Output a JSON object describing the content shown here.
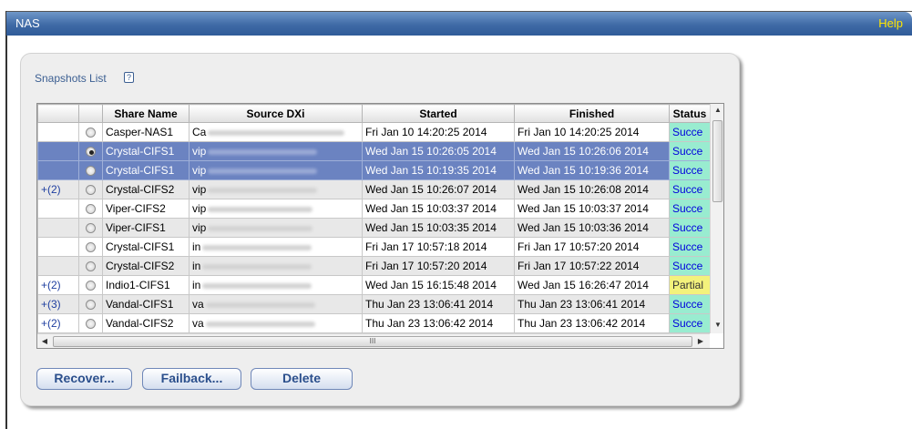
{
  "window": {
    "title": "NAS",
    "help_label": "Help"
  },
  "section": {
    "title": "Snapshots List",
    "help_icon": "?"
  },
  "table": {
    "columns": [
      "",
      "",
      "Share Name",
      "Source DXi",
      "Started",
      "Finished",
      "Status"
    ],
    "rows": [
      {
        "expand": "",
        "selected": false,
        "share": "Casper-NAS1",
        "source": "Ca",
        "started": "Fri Jan 10 14:20:25 2014",
        "finished": "Fri Jan 10 14:20:25 2014",
        "status": "Succe"
      },
      {
        "expand": "",
        "selected": true,
        "share": "Crystal-CIFS1",
        "source": "vip",
        "started": "Wed Jan 15 10:26:05 2014",
        "finished": "Wed Jan 15 10:26:06 2014",
        "status": "Succe"
      },
      {
        "expand": "",
        "selected": false,
        "share": "Crystal-CIFS1",
        "source": "vip",
        "started": "Wed Jan 15 10:19:35 2014",
        "finished": "Wed Jan 15 10:19:36 2014",
        "status": "Succe"
      },
      {
        "expand": "+(2)",
        "selected": false,
        "share": "Crystal-CIFS2",
        "source": "vip",
        "started": "Wed Jan 15 10:26:07 2014",
        "finished": "Wed Jan 15 10:26:08 2014",
        "status": "Succe"
      },
      {
        "expand": "",
        "selected": false,
        "share": "Viper-CIFS2",
        "source": "vip",
        "started": "Wed Jan 15 10:03:37 2014",
        "finished": "Wed Jan 15 10:03:37 2014",
        "status": "Succe"
      },
      {
        "expand": "",
        "selected": false,
        "share": "Viper-CIFS1",
        "source": "vip",
        "started": "Wed Jan 15 10:03:35 2014",
        "finished": "Wed Jan 15 10:03:36 2014",
        "status": "Succe"
      },
      {
        "expand": "",
        "selected": false,
        "share": "Crystal-CIFS1",
        "source": "in",
        "started": "Fri Jan 17 10:57:18 2014",
        "finished": "Fri Jan 17 10:57:20 2014",
        "status": "Succe"
      },
      {
        "expand": "",
        "selected": false,
        "share": "Crystal-CIFS2",
        "source": "in",
        "started": "Fri Jan 17 10:57:20 2014",
        "finished": "Fri Jan 17 10:57:22 2014",
        "status": "Succe"
      },
      {
        "expand": "+(2)",
        "selected": false,
        "share": "Indio1-CIFS1",
        "source": "in",
        "started": "Wed Jan 15 16:15:48 2014",
        "finished": "Wed Jan 15 16:26:47 2014",
        "status": "Partial"
      },
      {
        "expand": "+(3)",
        "selected": false,
        "share": "Vandal-CIFS1",
        "source": "va",
        "started": "Thu Jan 23 13:06:41 2014",
        "finished": "Thu Jan 23 13:06:41 2014",
        "status": "Succe"
      },
      {
        "expand": "+(2)",
        "selected": false,
        "share": "Vandal-CIFS2",
        "source": "va",
        "started": "Thu Jan 23 13:06:42 2014",
        "finished": "Thu Jan 23 13:06:42 2014",
        "status": "Succe"
      }
    ]
  },
  "buttons": {
    "recover": "Recover...",
    "failback": "Failback...",
    "delete": "Delete"
  },
  "colors": {
    "title_bar": "#3f6aa6",
    "selected_row": "#6b83c1",
    "status_success": "#99ecd0",
    "status_partial": "#f3f27c",
    "help_text": "#ffe600"
  }
}
